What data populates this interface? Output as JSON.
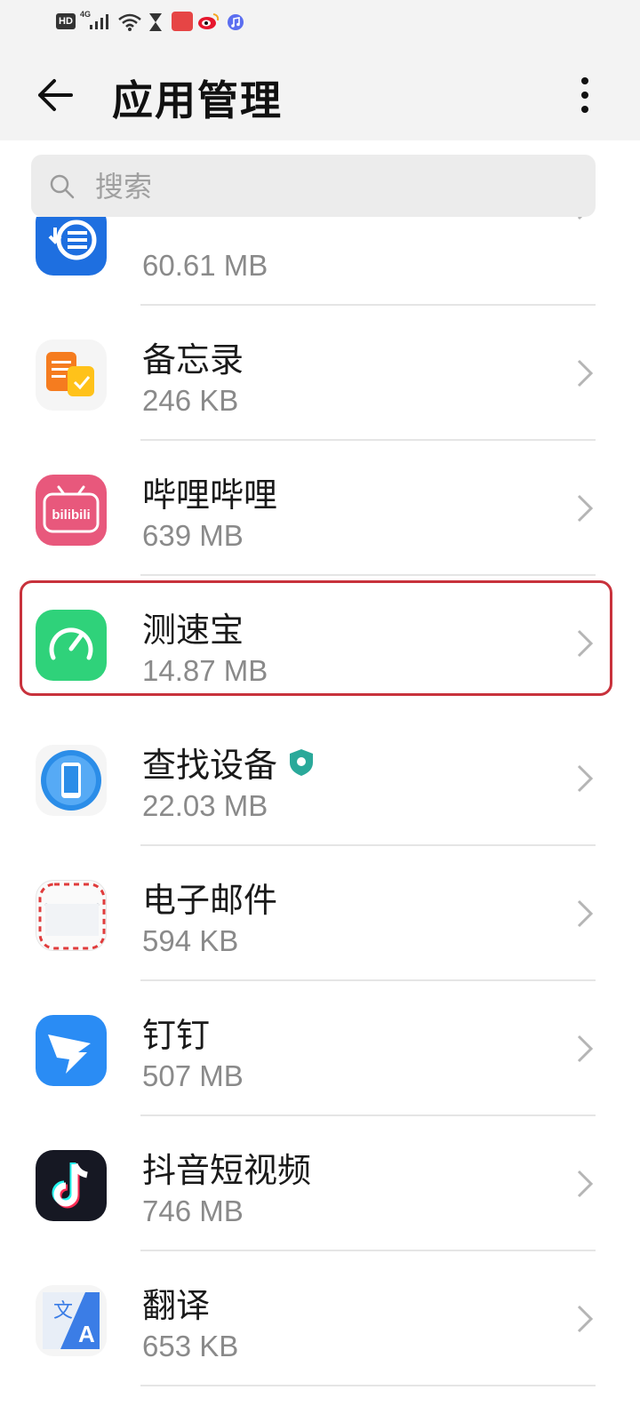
{
  "header": {
    "title": "应用管理",
    "back_icon": "arrow-left-icon",
    "more_icon": "more-vertical-icon"
  },
  "search": {
    "placeholder": "搜索",
    "icon": "search-icon"
  },
  "apps": [
    {
      "name": "",
      "size": "60.61 MB",
      "icon": "download-manager-icon",
      "icon_color": "#1e6fe0"
    },
    {
      "name": "备忘录",
      "size": "246 KB",
      "icon": "notepad-icon",
      "icon_color": "#f57c1f"
    },
    {
      "name": "哔哩哔哩",
      "size": "639 MB",
      "icon": "bilibili-icon",
      "icon_color": "#e8587c"
    },
    {
      "name": "测速宝",
      "size": "14.87 MB",
      "icon": "speedometer-icon",
      "icon_color": "#2fd27a",
      "highlighted": true
    },
    {
      "name": "查找设备",
      "size": "22.03 MB",
      "icon": "find-device-icon",
      "icon_color": "#2b8de8",
      "badge": "shield-badge-icon"
    },
    {
      "name": "电子邮件",
      "size": "594 KB",
      "icon": "email-envelope-icon",
      "icon_color": "#e03c3c"
    },
    {
      "name": "钉钉",
      "size": "507 MB",
      "icon": "dingtalk-icon",
      "icon_color": "#2a8cf4"
    },
    {
      "name": "抖音短视频",
      "size": "746 MB",
      "icon": "douyin-icon",
      "icon_color": "#161823"
    },
    {
      "name": "翻译",
      "size": "653 KB",
      "icon": "translate-icon",
      "icon_color": "#3b7de6"
    }
  ],
  "colors": {
    "highlight_border": "#c8323c",
    "secondary_text": "#8a8a8a",
    "header_bg": "#f3f3f3"
  }
}
